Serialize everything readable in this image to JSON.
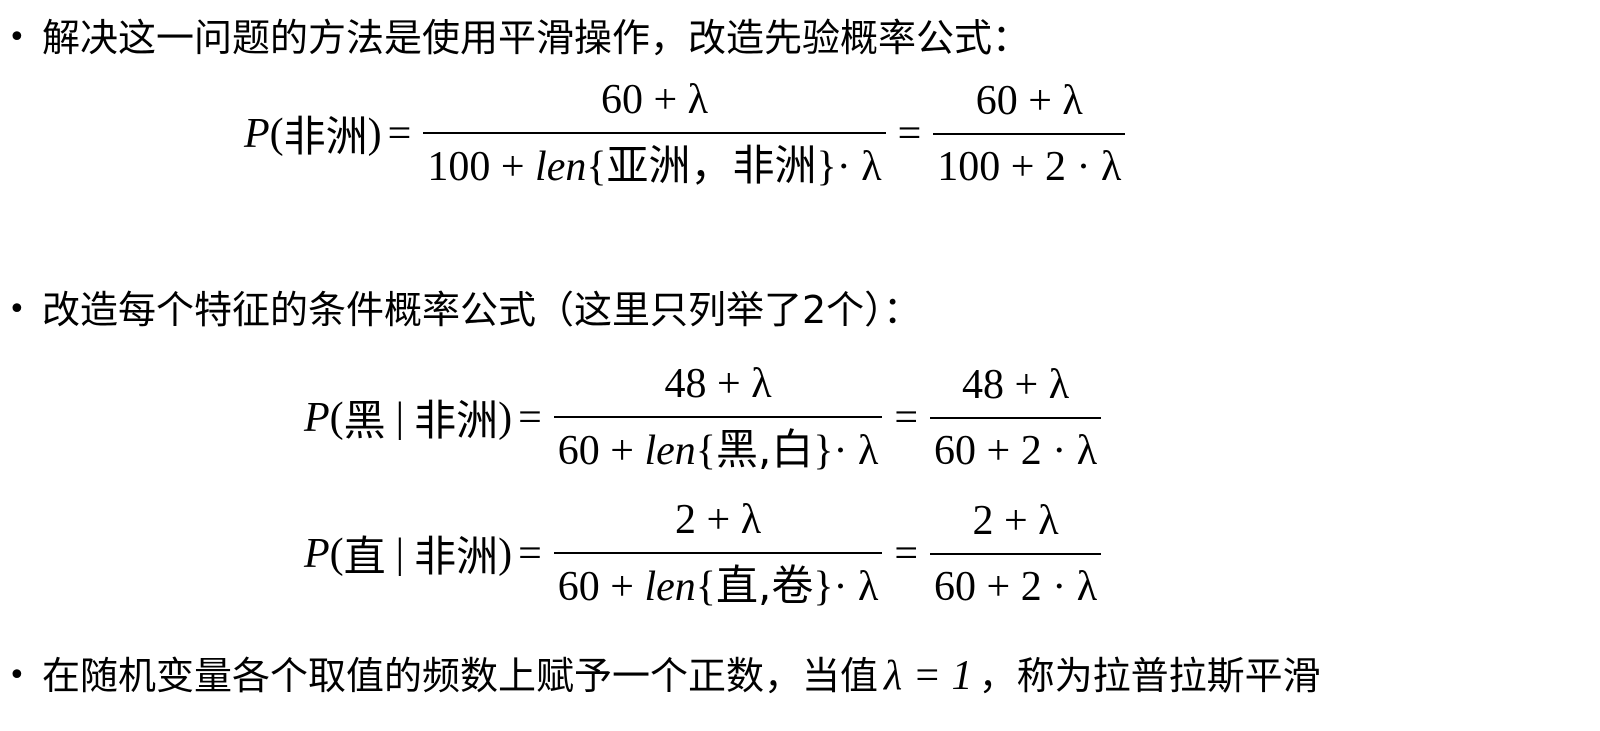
{
  "bullets": [
    {
      "text": "解决这一问题的方法是使用平滑操作，改造先验概率公式："
    },
    {
      "text": "改造每个特征的条件概率公式（这里只列举了2个）："
    },
    {
      "text_before": "在随机变量各个取值的频数上赋予一个正数，当值",
      "lambda_eq": "λ = 1",
      "text_after": "，称为拉普拉斯平滑"
    }
  ],
  "formula_prior": {
    "P": "P",
    "arg": "非洲",
    "frac1_num": "60 + λ",
    "frac1_den_pre": "100 + ",
    "len": "len",
    "set": "亚洲，非洲",
    "frac1_den_post": "· λ",
    "frac2_num": "60 + λ",
    "frac2_den": "100 + 2 · λ"
  },
  "formula_black": {
    "P": "P",
    "cond_a": "黑",
    "cond_b": "非洲",
    "frac1_num": "48 + λ",
    "frac1_den_pre": "60 + ",
    "len": "len",
    "set": "黑,白",
    "frac1_den_post": "· λ",
    "frac2_num": "48 + λ",
    "frac2_den": "60 + 2 · λ"
  },
  "formula_straight": {
    "P": "P",
    "cond_a": "直",
    "cond_b": "非洲",
    "frac1_num": "2 + λ",
    "frac1_den_pre": "60 + ",
    "len": "len",
    "set": "直,卷",
    "frac1_den_post": "· λ",
    "frac2_num": "2 + λ",
    "frac2_den": "60 + 2 · λ"
  }
}
